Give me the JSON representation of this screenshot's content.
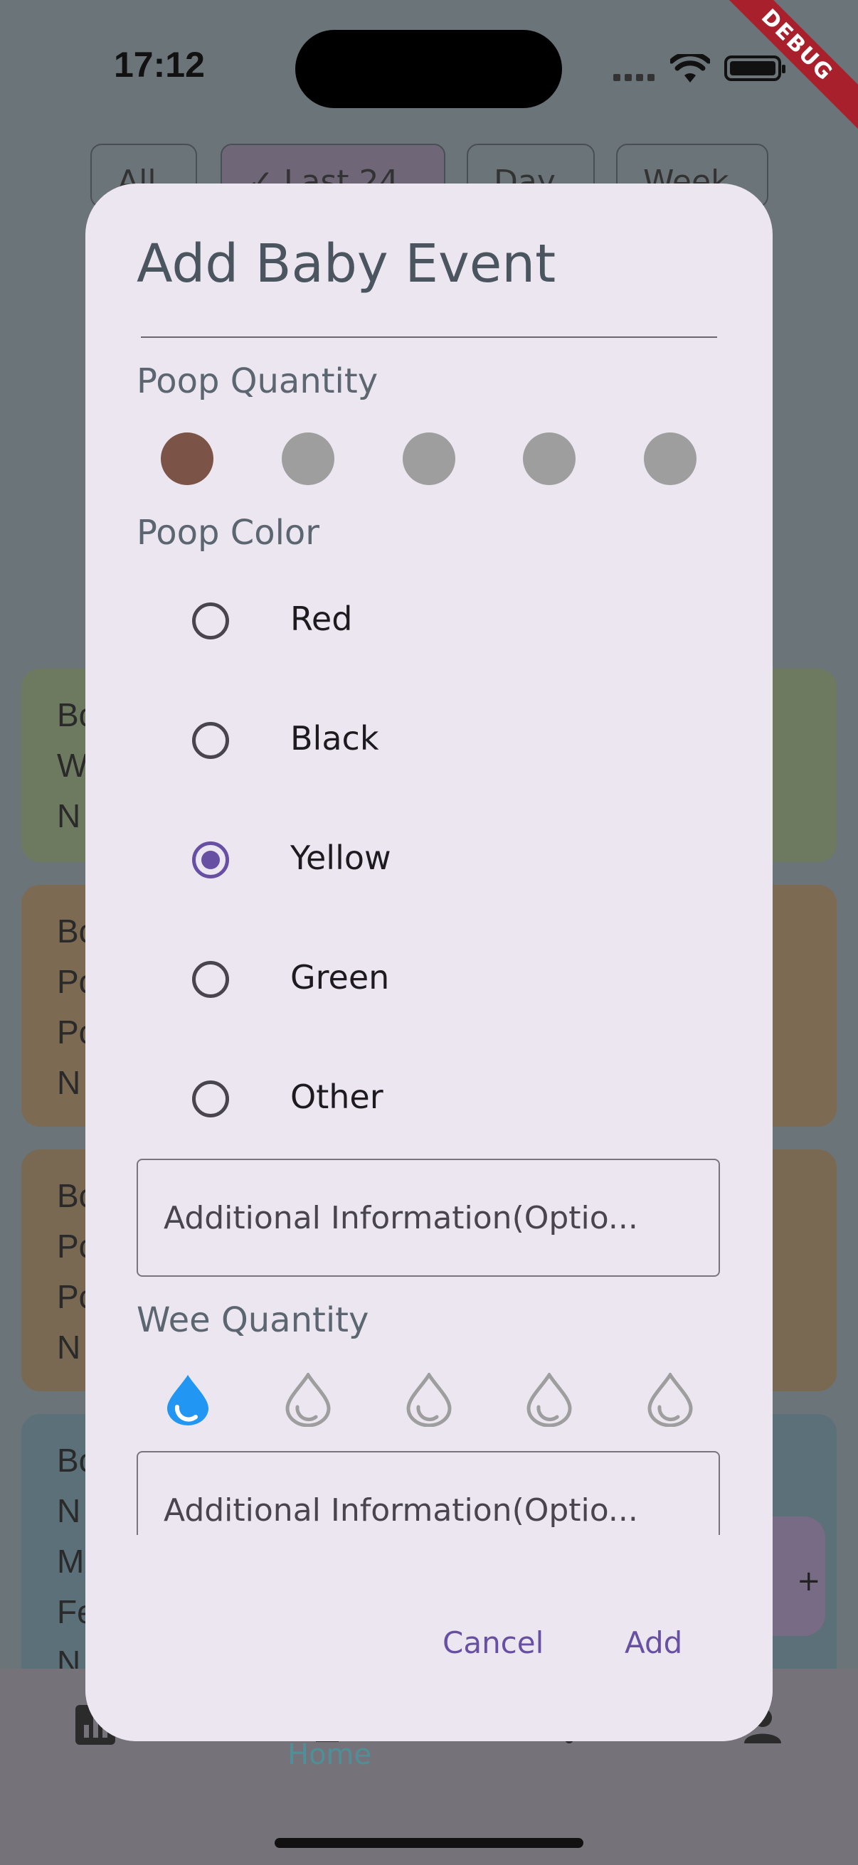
{
  "status_bar": {
    "time": "17:12",
    "debug_banner": "DEBUG"
  },
  "filter_chips": [
    {
      "label": "All",
      "selected": false
    },
    {
      "label": "✓ Last 24",
      "selected": true
    },
    {
      "label": "Day",
      "selected": false
    },
    {
      "label": "Week",
      "selected": false
    }
  ],
  "background_cards": [
    {
      "color": "#6e7a60",
      "lines": [
        "Bc",
        "W",
        "N"
      ]
    },
    {
      "color": "#7c6a52",
      "lines": [
        "Bc",
        "Pc",
        "Pc",
        "N"
      ]
    },
    {
      "color": "#796953",
      "lines": [
        "Bc",
        "Pc",
        "Pc",
        "N"
      ]
    },
    {
      "color": "#5c7079",
      "lines": [
        "Bc",
        "N",
        "M",
        "Fe",
        "N"
      ]
    }
  ],
  "fab": {
    "glyph": "+"
  },
  "bottom_nav": {
    "active_label": "Home",
    "icons": [
      "chart-icon",
      "home-icon",
      "profile-icon"
    ]
  },
  "dialog": {
    "title": "Add Baby Event",
    "poop_quantity": {
      "label": "Poop Quantity",
      "level": 1,
      "max": 5,
      "active_color": "#7b5447",
      "inactive_color": "#9e9e9e"
    },
    "poop_color": {
      "label": "Poop Color",
      "options": [
        "Red",
        "Black",
        "Yellow",
        "Green",
        "Other"
      ],
      "selected": "Yellow"
    },
    "poop_additional": {
      "placeholder": "Additional Information(Optio..."
    },
    "wee_quantity": {
      "label": "Wee Quantity",
      "level": 1,
      "max": 5,
      "active_color": "#2196f3",
      "inactive_color": "#9e9e9e"
    },
    "wee_additional": {
      "placeholder": "Additional Information(Optio..."
    },
    "buttons": {
      "cancel": "Cancel",
      "add": "Add"
    }
  }
}
